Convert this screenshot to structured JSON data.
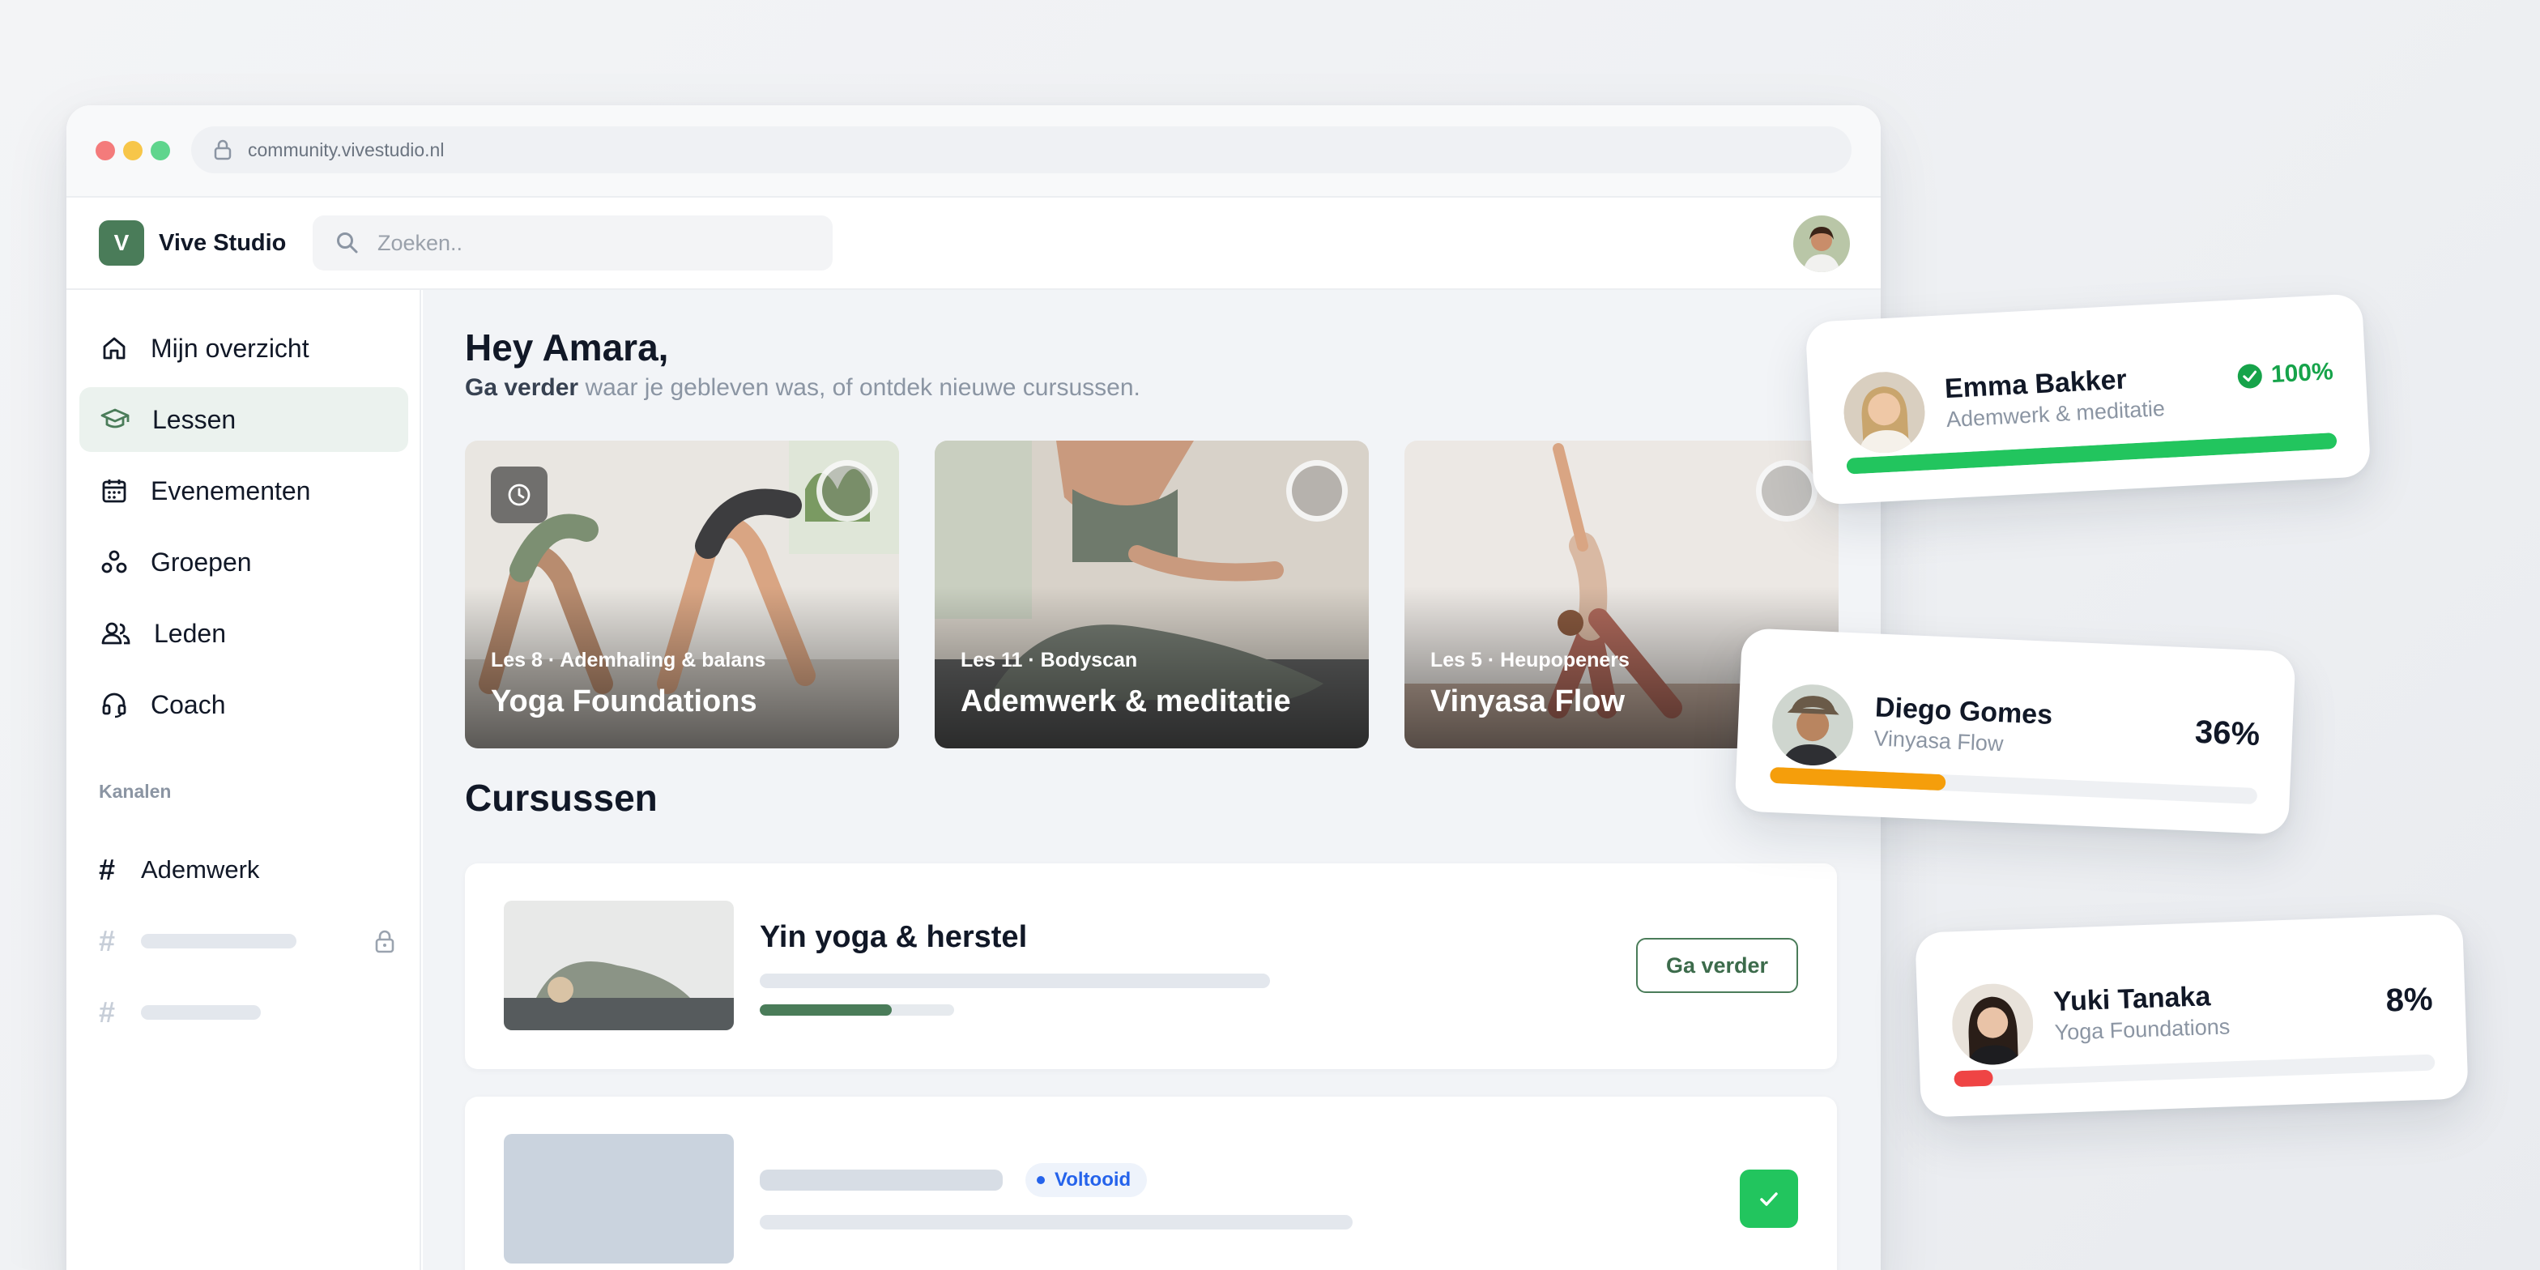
{
  "browser": {
    "url": "community.vivestudio.nl"
  },
  "header": {
    "logo_letter": "V",
    "brand": "Vive Studio",
    "search_placeholder": "Zoeken.."
  },
  "sidebar": {
    "items": [
      {
        "label": "Mijn overzicht",
        "icon": "home-icon",
        "active": false
      },
      {
        "label": "Lessen",
        "icon": "graduation-cap-icon",
        "active": true
      },
      {
        "label": "Evenementen",
        "icon": "calendar-icon",
        "active": false
      },
      {
        "label": "Groepen",
        "icon": "groups-icon",
        "active": false
      },
      {
        "label": "Leden",
        "icon": "members-icon",
        "active": false
      },
      {
        "label": "Coach",
        "icon": "headset-icon",
        "active": false
      }
    ],
    "channels_title": "Kanalen",
    "channels": [
      {
        "hash": "#",
        "label": "Ademwerk"
      },
      {
        "hash": "#",
        "locked": true
      },
      {
        "hash": "#"
      }
    ]
  },
  "main": {
    "greeting": "Hey Amara,",
    "sub_bold": "Ga verder",
    "sub_rest": "waar je gebleven was, of ontdek nieuwe cursussen.",
    "lessons": [
      {
        "meta": "Les 8 · Ademhaling & balans",
        "title": "Yoga Foundations"
      },
      {
        "meta": "Les 11 · Bodyscan",
        "title": "Ademwerk & meditatie"
      },
      {
        "meta": "Les 5 · Heupopeners",
        "title": "Vinyasa Flow"
      }
    ],
    "courses_title": "Cursussen",
    "courses": [
      {
        "title": "Yin yoga & herstel",
        "button": "Ga verder",
        "progress": 0.68
      },
      {
        "badge": "Voltooid"
      }
    ]
  },
  "progress_cards": [
    {
      "name": "Emma Bakker",
      "course": "Ademwerk & meditatie",
      "percent": "100%",
      "value": 1.0,
      "color": "#22c55e"
    },
    {
      "name": "Diego Gomes",
      "course": "Vinyasa Flow",
      "percent": "36%",
      "value": 0.36,
      "color": "#f59e0b"
    },
    {
      "name": "Yuki Tanaka",
      "course": "Yoga Foundations",
      "percent": "8%",
      "value": 0.08,
      "color": "#ef4444"
    }
  ]
}
